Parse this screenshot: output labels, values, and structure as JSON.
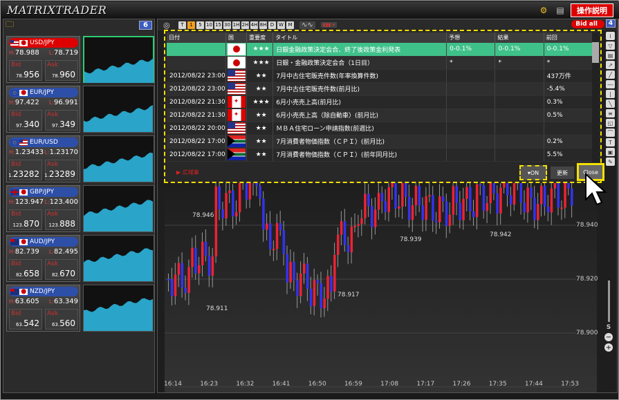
{
  "app": {
    "title": "MATRIXTRADER",
    "help_label": "操作説明"
  },
  "left": {
    "count": "6"
  },
  "pairs": [
    {
      "name": "USD/JPY",
      "h": "78.988",
      "l": "78.719",
      "bid_label": "Bid",
      "ask_label": "Ask",
      "bid_small": "78.",
      "bid_big": "956",
      "ask_small": "78.",
      "ask_big": "960",
      "selected": true
    },
    {
      "name": "EUR/JPY",
      "h": "97.422",
      "l": "96.991",
      "bid_label": "Bid",
      "ask_label": "Ask",
      "bid_small": "97.",
      "bid_big": "340",
      "ask_small": "97.",
      "ask_big": "349"
    },
    {
      "name": "EUR/USD",
      "h": "1.23433",
      "l": "1.23170",
      "bid_label": "Bid",
      "ask_label": "Ask",
      "bid_small": "1.",
      "bid_big": "23282",
      "ask_small": "1.",
      "ask_big": "23289"
    },
    {
      "name": "GBP/JPY",
      "h": "123.947",
      "l": "123.400",
      "bid_label": "Bid",
      "ask_label": "Ask",
      "bid_small": "123.",
      "bid_big": "870",
      "ask_small": "123.",
      "ask_big": "888"
    },
    {
      "name": "AUD/JPY",
      "h": "82.739",
      "l": "82.495",
      "bid_label": "Bid",
      "ask_label": "Ask",
      "bid_small": "82.",
      "bid_big": "658",
      "ask_small": "82.",
      "ask_big": "670"
    },
    {
      "name": "NZD/JPY",
      "h": "63.605",
      "l": "63.349",
      "bid_label": "Bid",
      "ask_label": "Ask",
      "bid_small": "63.",
      "bid_big": "542",
      "ask_small": "63.",
      "ask_big": "560"
    }
  ],
  "toolbar": {
    "timeframes": [
      "T",
      "1",
      "5",
      "10",
      "15",
      "30",
      "1H",
      "2H",
      "4H",
      "8H",
      "D",
      "W",
      "M"
    ],
    "active": "1",
    "bid_all": "Bid all",
    "count": "4"
  },
  "news": {
    "headers": [
      "日付",
      "国",
      "重要度",
      "タイトル",
      "予想",
      "結果",
      "前回"
    ],
    "rows": [
      {
        "date": "",
        "country": "JP",
        "stars": "★★★",
        "title": "日銀金融政策決定会合、終了後政策金利発表",
        "forecast": "0-0.1%",
        "result": "0-0.1%",
        "previous": "0-0.1%",
        "hl": true
      },
      {
        "date": "",
        "country": "JP",
        "stars": "★★★",
        "title": "日銀・金融政策決定会合（1日目）",
        "forecast": "*",
        "result": "*",
        "previous": "*"
      },
      {
        "date": "2012/08/22 23:00",
        "country": "US",
        "stars": "★★",
        "title": "7月中古住宅販売件数(年率換算件数)",
        "forecast": "",
        "result": "",
        "previous": "437万件"
      },
      {
        "date": "2012/08/22 23:00",
        "country": "US",
        "stars": "★★",
        "title": "7月中古住宅販売件数(前月比)",
        "forecast": "",
        "result": "",
        "previous": "-5.4%"
      },
      {
        "date": "2012/08/22 21:30",
        "country": "CA",
        "stars": "★★★",
        "title": "6月小売売上高(前月比)",
        "forecast": "",
        "result": "",
        "previous": "0.3%"
      },
      {
        "date": "2012/08/22 21:30",
        "country": "CA",
        "stars": "★★",
        "title": "6月小売売上高（除自動車）(前月比)",
        "forecast": "",
        "result": "",
        "previous": "0.5%"
      },
      {
        "date": "2012/08/22 20:00",
        "country": "US",
        "stars": "★★",
        "title": "ＭＢＡ住宅ローン申請指数(前週比)",
        "forecast": "",
        "result": "",
        "previous": ""
      },
      {
        "date": "2012/08/22 17:00",
        "country": "ZA",
        "stars": "★★",
        "title": "7月消費者物価指数（ＣＰＩ）(前月比)",
        "forecast": "",
        "result": "",
        "previous": "0.2%"
      },
      {
        "date": "2012/08/22 17:00",
        "country": "ZA",
        "stars": "★★",
        "title": "7月消費者物価指数（ＣＰＩ）(前年同月比)",
        "forecast": "",
        "result": "",
        "previous": "5.5%"
      }
    ],
    "footer_date": "▶ 広域事",
    "on_label": "▾ON",
    "refresh_label": "更新",
    "close_label": "Close"
  },
  "chart": {
    "x_ticks": [
      "16:14",
      "16:23",
      "16:32",
      "16:41",
      "16:50",
      "16:59",
      "17:08",
      "17:17",
      "17:26",
      "17:35",
      "17:44",
      "17:53"
    ],
    "y_ticks": [
      "78.940",
      "78.920",
      "78.900"
    ],
    "annotations": [
      "78.946",
      "78.911",
      "78.917",
      "78.939",
      "78.942"
    ],
    "zoom_label": "S"
  }
}
